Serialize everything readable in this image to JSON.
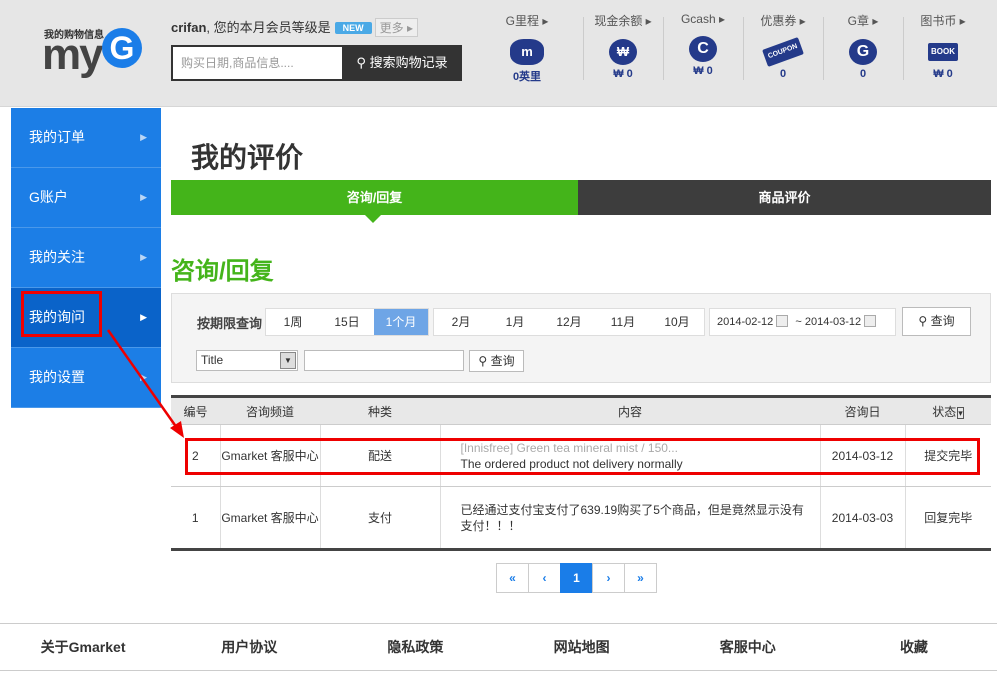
{
  "header": {
    "logo_small": "我的购物信息",
    "logo_text": "my",
    "logo_g": "G",
    "username": "crifan",
    "greeting": ", 您的本月会员等级是",
    "badge": "NEW",
    "more": "更多",
    "search_placeholder": "购买日期,商品信息....",
    "search_button": "搜索购物记录",
    "stats": [
      {
        "label": "G里程",
        "value": "0英里",
        "icon": "piggy-m-icon",
        "glyph": "m"
      },
      {
        "label": "现金余额",
        "value": "₩ 0",
        "icon": "money-bag-icon",
        "glyph": "₩"
      },
      {
        "label": "Gcash",
        "value": "₩ 0",
        "icon": "gcash-c-icon",
        "glyph": "C"
      },
      {
        "label": "优惠券",
        "value": "0",
        "icon": "coupon-icon",
        "glyph": "COUPON"
      },
      {
        "label": "G章",
        "value": "0",
        "icon": "g-stamp-icon",
        "glyph": "G"
      },
      {
        "label": "图书币",
        "value": "₩ 0",
        "icon": "book-icon",
        "glyph": "BOOK"
      }
    ]
  },
  "sidebar": {
    "items": [
      {
        "label": "我的订单"
      },
      {
        "label": "G账户"
      },
      {
        "label": "我的关注"
      },
      {
        "label": "我的询问",
        "active": true
      },
      {
        "label": "我的设置"
      }
    ]
  },
  "main": {
    "title": "我的评价",
    "tabs": [
      {
        "label": "咨询/回复",
        "active": true
      },
      {
        "label": "商品评价"
      }
    ],
    "section_title": "咨询/回复",
    "filter": {
      "label": "按期限查询",
      "periods_a": [
        "1周",
        "15日",
        "1个月"
      ],
      "active_period": "1个月",
      "periods_b": [
        "2月",
        "1月",
        "12月",
        "11月",
        "10月"
      ],
      "date_from": "2014-02-12",
      "date_sep": "~",
      "date_to": "2014-03-12",
      "query_button": "查询",
      "select_value": "Title",
      "text_value": "",
      "query_button2": "查询"
    },
    "table": {
      "headers": [
        "编号",
        "咨询频道",
        "种类",
        "内容",
        "咨询日",
        "状态"
      ],
      "rows": [
        {
          "no": "2",
          "channel": "Gmarket 客服中心",
          "type": "配送",
          "content_gray": "[Innisfree] Green tea mineral mist / 150...",
          "content": "The ordered product not delivery normally",
          "date": "2014-03-12",
          "status": "提交完毕"
        },
        {
          "no": "1",
          "channel": "Gmarket 客服中心",
          "type": "支付",
          "content_gray": "",
          "content": "已经通过支付宝支付了639.19购买了5个商品，但是竟然显示没有支付！！！",
          "date": "2014-03-03",
          "status": "回复完毕"
        }
      ]
    },
    "pager": {
      "first": "«",
      "prev": "‹",
      "current": "1",
      "next": "›",
      "last": "»"
    }
  },
  "footer": {
    "links": [
      "关于Gmarket",
      "用户协议",
      "隐私政策",
      "网站地图",
      "客服中心",
      "收藏"
    ]
  },
  "colors": {
    "brand_blue": "#1c7ee6",
    "green": "#44b41a",
    "dark": "#3d3d3d",
    "icon_navy": "#243a8a",
    "annotation_red": "#ee0000"
  }
}
